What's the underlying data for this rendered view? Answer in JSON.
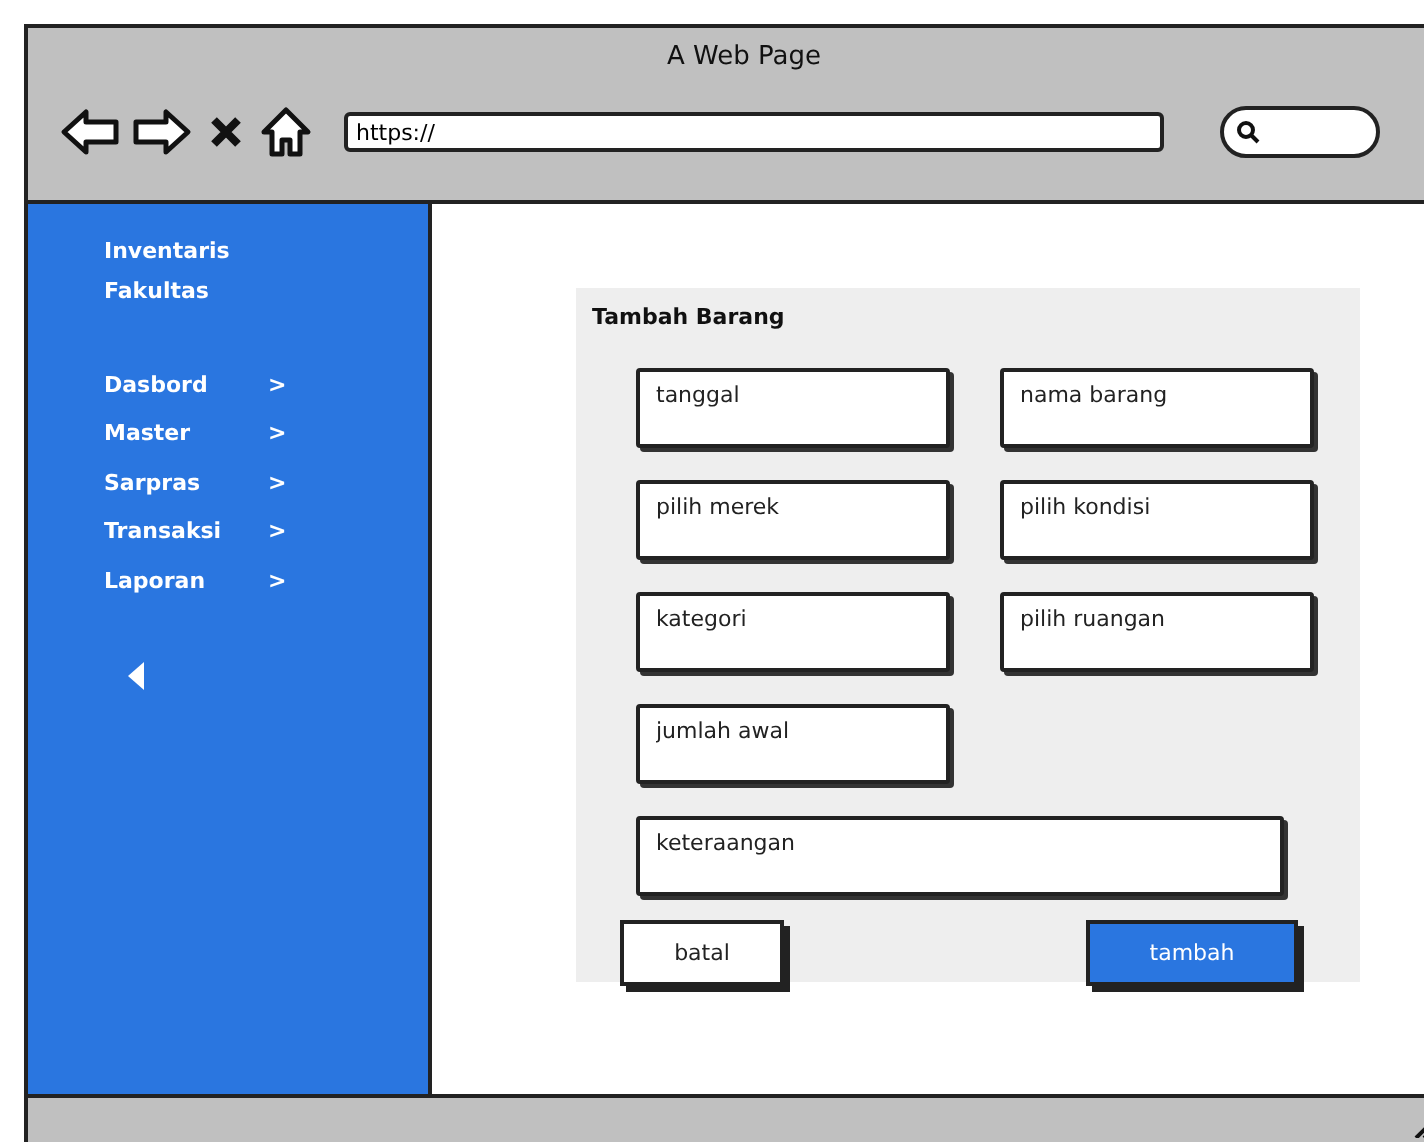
{
  "window": {
    "title": "A Web Page"
  },
  "toolbar": {
    "url": "https://"
  },
  "sidebar": {
    "headers": [
      "Inventaris",
      "Fakultas"
    ],
    "items": [
      {
        "label": "Dasbord",
        "chevron": ">"
      },
      {
        "label": "Master",
        "chevron": ">"
      },
      {
        "label": "Sarpras",
        "chevron": ">"
      },
      {
        "label": "Transaksi",
        "chevron": ">"
      },
      {
        "label": "Laporan",
        "chevron": ">"
      }
    ]
  },
  "form": {
    "title": "Tambah Barang",
    "fields": [
      {
        "placeholder": "tanggal",
        "kind": "half"
      },
      {
        "placeholder": "nama barang",
        "kind": "half"
      },
      {
        "placeholder": "pilih merek",
        "kind": "half"
      },
      {
        "placeholder": "pilih kondisi",
        "kind": "half"
      },
      {
        "placeholder": "kategori",
        "kind": "half"
      },
      {
        "placeholder": "pilih ruangan",
        "kind": "half"
      },
      {
        "placeholder": "jumlah awal",
        "kind": "half"
      },
      {
        "placeholder": "keteraangan",
        "kind": "wide"
      }
    ],
    "buttons": [
      {
        "label": "batal",
        "kind": "secondary"
      },
      {
        "label": "tambah",
        "kind": "primary"
      }
    ]
  }
}
